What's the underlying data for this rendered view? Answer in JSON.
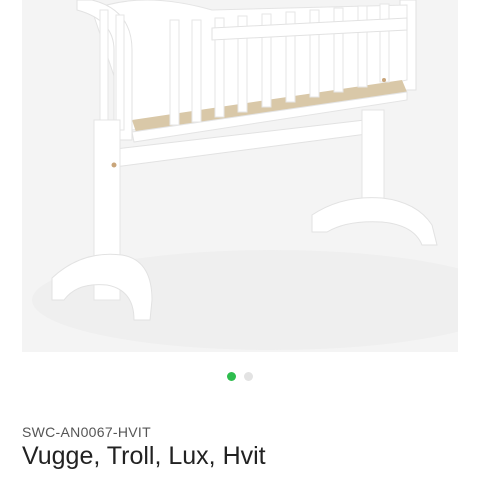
{
  "product": {
    "sku": "SWC-AN0067-HVIT",
    "title": "Vugge, Troll, Lux, Hvit",
    "image_alt_icon": "cradle-photo"
  },
  "carousel": {
    "slides": 2,
    "active_index": 0,
    "active_color": "#2ebd4e",
    "inactive_color": "#e3e3e3"
  }
}
